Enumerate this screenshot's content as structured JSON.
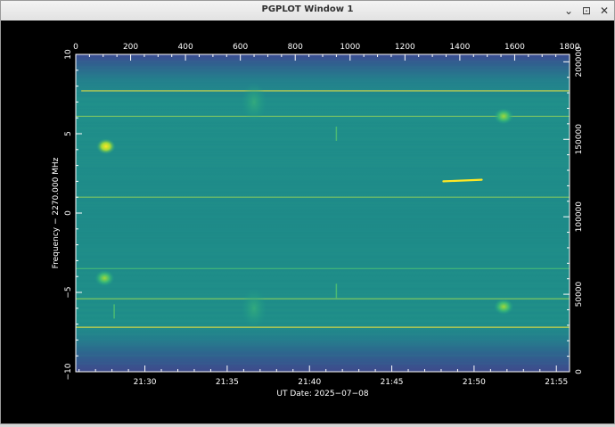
{
  "window": {
    "title": "PGPLOT Window 1",
    "minimize_glyph": "⌄",
    "maximize_glyph": "⊡",
    "close_glyph": "✕"
  },
  "plot": {
    "ylabel": "Frequency − 2270.000 MHz",
    "xlabel": "UT Date: 2025−07−08",
    "colormap": [
      "#46327e",
      "#365c8d",
      "#277f8e",
      "#1fa187",
      "#4ac16d",
      "#a0da39",
      "#fde725"
    ],
    "left_axis_ticks": [
      "10",
      "5",
      "0",
      "−5",
      "−10"
    ],
    "bottom_axis_ticks": [
      "21:30",
      "21:35",
      "21:40",
      "21:45",
      "21:50",
      "21:55"
    ],
    "top_axis_ticks": [
      "0",
      "200",
      "400",
      "600",
      "800",
      "1000",
      "1200",
      "1400",
      "1600",
      "1800"
    ],
    "right_axis_ticks": [
      "0",
      "50000",
      "100000",
      "150000",
      "200000"
    ]
  },
  "chart_data": {
    "type": "heatmap",
    "title": "",
    "xlabel": "UT Date: 2025−07−08",
    "ylabel": "Frequency − 2270.000 MHz",
    "xlim_ut_minutes": [
      "21:25.8",
      "21:55.8"
    ],
    "ylim": [
      -10,
      10
    ],
    "x2lim": [
      0,
      1800
    ],
    "y2lim": [
      0,
      204800
    ],
    "background_level": "teal (mid colormap)",
    "band_edges": "dark blue roll-off above ~8.5 MHz and below ~-8 MHz",
    "features": [
      {
        "kind": "horizontal_line",
        "freq": 7.7,
        "x_range": [
          20,
          1800
        ],
        "level": "yellow"
      },
      {
        "kind": "horizontal_line",
        "freq": 6.1,
        "x_range": [
          0,
          1800
        ],
        "level": "light green"
      },
      {
        "kind": "horizontal_line",
        "freq": 1.0,
        "x_range": [
          0,
          1800
        ],
        "level": "light green"
      },
      {
        "kind": "horizontal_line",
        "freq": -3.5,
        "x_range": [
          0,
          1800
        ],
        "level": "green"
      },
      {
        "kind": "horizontal_line",
        "freq": -5.4,
        "x_range": [
          0,
          1800
        ],
        "level": "light green"
      },
      {
        "kind": "horizontal_line",
        "freq": -7.2,
        "x_range": [
          0,
          1800
        ],
        "level": "yellow"
      },
      {
        "kind": "hot_spot",
        "x": 110,
        "freq": 4.2,
        "level": "yellow"
      },
      {
        "kind": "hot_spot",
        "x": 105,
        "freq": -4.1,
        "level": "yellow-green"
      },
      {
        "kind": "hot_spot",
        "x": 1560,
        "freq": 6.1,
        "level": "yellow-green"
      },
      {
        "kind": "hot_spot",
        "x": 1560,
        "freq": -5.9,
        "level": "green"
      },
      {
        "kind": "diffuse_blob",
        "x": 650,
        "freq": 7.0,
        "level": "green"
      },
      {
        "kind": "diffuse_blob",
        "x": 650,
        "freq": -6.0,
        "level": "green"
      },
      {
        "kind": "diagonal_streak",
        "x_range": [
          1340,
          1480
        ],
        "freq_range": [
          2.0,
          2.1
        ],
        "level": "yellow"
      },
      {
        "kind": "short_vertical_mark",
        "x": 950,
        "freq": 5.0,
        "level": "green"
      },
      {
        "kind": "short_vertical_mark",
        "x": 950,
        "freq": -4.9,
        "level": "green"
      },
      {
        "kind": "short_vertical_mark",
        "x": 140,
        "freq": -6.2,
        "level": "green"
      }
    ]
  }
}
